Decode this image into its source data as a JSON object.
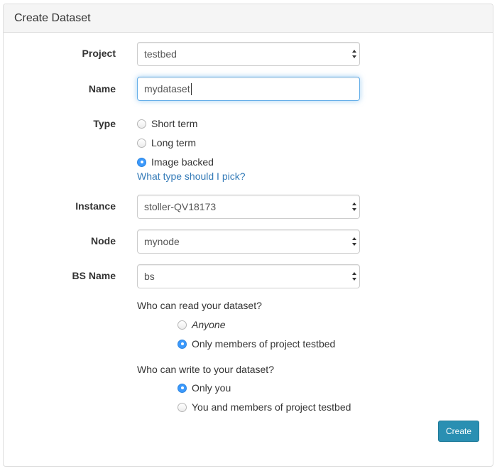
{
  "panel": {
    "title": "Create Dataset"
  },
  "form": {
    "project": {
      "label": "Project",
      "value": "testbed"
    },
    "name": {
      "label": "Name",
      "value": "mydataset"
    },
    "type": {
      "label": "Type",
      "options": [
        {
          "label": "Short term",
          "checked": false
        },
        {
          "label": "Long term",
          "checked": false
        },
        {
          "label": "Image backed",
          "checked": true
        }
      ],
      "help_link": "What type should I pick?"
    },
    "instance": {
      "label": "Instance",
      "value": "stoller-QV18173"
    },
    "node": {
      "label": "Node",
      "value": "mynode"
    },
    "bs_name": {
      "label": "BS Name",
      "value": "bs"
    },
    "read_access": {
      "question": "Who can read your dataset?",
      "options": [
        {
          "label": "Anyone",
          "checked": false
        },
        {
          "label": "Only members of project testbed",
          "checked": true
        }
      ]
    },
    "write_access": {
      "question": "Who can write to your dataset?",
      "options": [
        {
          "label": "Only you",
          "checked": true
        },
        {
          "label": "You and members of project testbed",
          "checked": false
        }
      ]
    },
    "submit_label": "Create"
  },
  "colors": {
    "primary_link": "#337ab7",
    "focus_border": "#66afe9",
    "radio_checked": "#3b99fc",
    "button_bg": "#2a8fb2"
  }
}
